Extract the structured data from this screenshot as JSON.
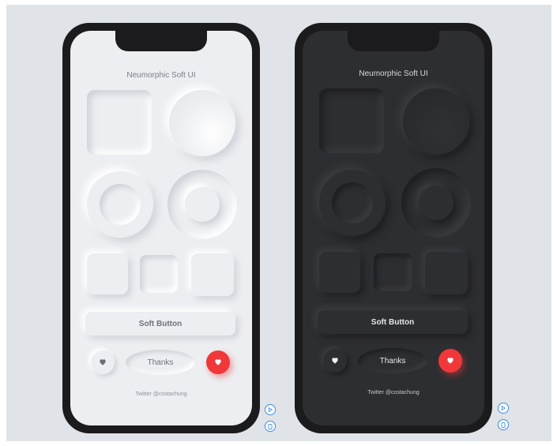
{
  "light": {
    "title": "Neumorphic Soft UI",
    "soft_button": "Soft Button",
    "thanks_button": "Thanks",
    "footer": "Twitter @costachung"
  },
  "dark": {
    "title": "Neumorphic Soft UI",
    "soft_button": "Soft Button",
    "thanks_button": "Thanks",
    "footer": "Twitter @costachung"
  },
  "icons": {
    "heart": "heart-icon",
    "side_play": "play-circle-icon",
    "side_page": "page-circle-icon"
  },
  "colors": {
    "background": "#e0e3e7",
    "light_surface": "#eceef1",
    "dark_surface": "#2d2e31",
    "accent_red": "#f0383a",
    "icon_blue": "#3d8be0"
  }
}
